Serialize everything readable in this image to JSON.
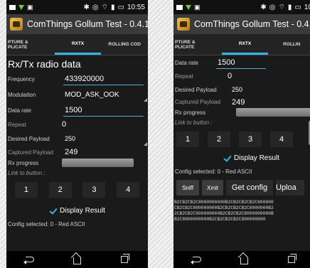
{
  "left": {
    "status": {
      "time": "10:55"
    },
    "app_title": "ComThings Gollum Test - 0.4.1",
    "tabs": {
      "capture_line1": "PTURE &",
      "capture_line2": "PLICATE",
      "rxtx": "RXTX",
      "rolling": "ROLLING COD"
    },
    "section_title": "Rx/Tx radio data",
    "fields": {
      "frequency_label": "Frequency",
      "frequency_value": "433920000",
      "modulation_label": "Modulation",
      "modulation_value": "MOD_ASK_OOK",
      "datarate_label": "Data rate",
      "datarate_value": "1500",
      "repeat_label": "Repeat",
      "repeat_value": "0",
      "desired_label": "Desired Payload",
      "desired_value": "250",
      "captured_label": "Captured Payload",
      "captured_value": "249",
      "rxprogress_label": "Rx progress"
    },
    "link_label": "Link to button :",
    "buttons": [
      "1",
      "2",
      "3",
      "4"
    ],
    "display_result": "Display Result",
    "config_selected": "Config selected:  0 - Red ASCII"
  },
  "right": {
    "status": {
      "time": "10"
    },
    "app_title": "ComThings Gollum Test - 0.4.1",
    "tabs": {
      "capture_line1": "PTURE &",
      "capture_line2": "PLICATE",
      "rxtx": "RXTX",
      "rolling": "ROLLIN"
    },
    "fields": {
      "datarate_label": "Data rate",
      "datarate_value": "1500",
      "repeat_label": "Repeat",
      "repeat_value": "0",
      "desired_label": "Desired Payload",
      "desired_value": "250",
      "captured_label": "Captured Payload",
      "captured_value": "249",
      "rxprogress_label": "Rx progress"
    },
    "link_label": "Link to button :",
    "buttons": [
      "1",
      "2",
      "3",
      "4"
    ],
    "display_result": "Display Result",
    "config_selected": "Config selected:  0 - Red ASCII",
    "action_buttons": {
      "sniff": "Sniff",
      "xmit": "Xmit",
      "get_config": "Get config",
      "upload": "Uploa"
    },
    "hex_lines": [
      "B2CB2CB2C8000000000B2CB2CB2CB2C800000",
      "CB2CB2C800000000B2CB2CB2CB2C8000000B2",
      "2CB2CB2C800000000B2CB2CB2C8000000000B",
      "B2C8000000000B2CB2CB2CB2C800000000"
    ]
  },
  "colors": {
    "accent": "#33b5e5"
  }
}
